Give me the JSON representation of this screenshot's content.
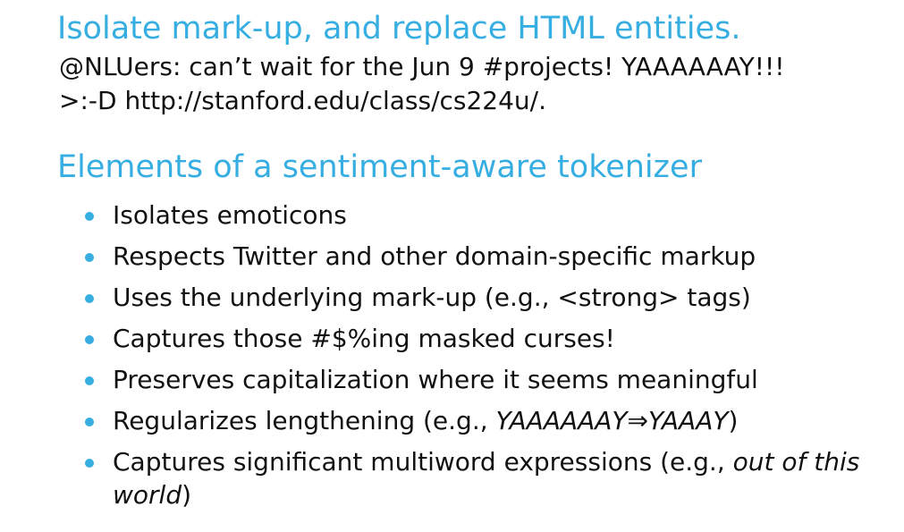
{
  "heading1": "Isolate mark-up, and replace HTML entities.",
  "example": {
    "line1": "@NLUers: can’t wait for the Jun 9 #projects! YAAAAAAY!!!",
    "line2": ">:-D http://stanford.edu/class/cs224u/."
  },
  "heading2": "Elements of a sentiment-aware tokenizer",
  "bullets": [
    {
      "text": "Isolates emoticons"
    },
    {
      "text": "Respects Twitter and other domain-specific markup"
    },
    {
      "text": "Uses the underlying mark-up (e.g., <strong> tags)"
    },
    {
      "text": "Captures those #$%ing masked curses!"
    },
    {
      "text": "Preserves capitalization where it seems meaningful"
    },
    {
      "prefix": "Regularizes lengthening (e.g., ",
      "italic": "YAAAAAAY⇒YAAAY",
      "suffix": ")"
    },
    {
      "prefix": "Captures significant multiword expressions (e.g., ",
      "italic": "out of this world",
      "suffix": ")"
    }
  ],
  "colors": {
    "heading": "#37aee2",
    "text": "#111111",
    "bullet": "#37aee2"
  }
}
